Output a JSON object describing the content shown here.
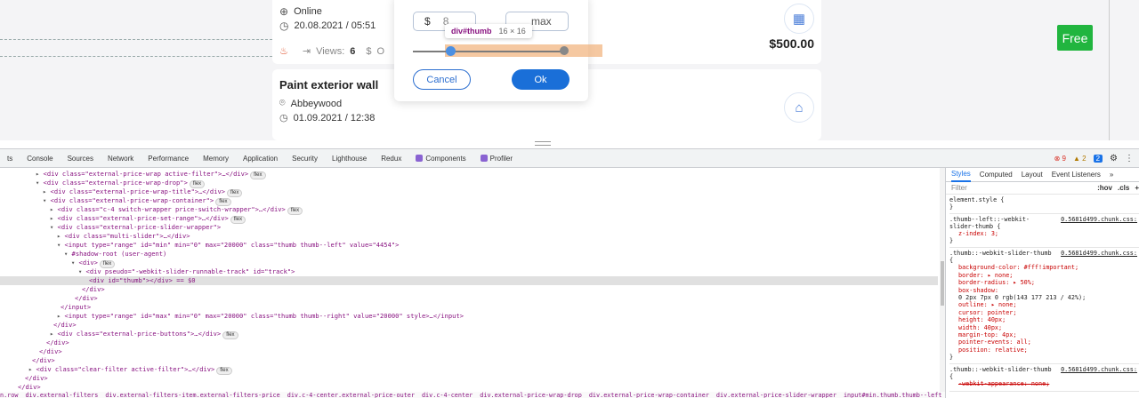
{
  "page": {
    "card1": {
      "location_label": "Online",
      "datetime": "20.08.2021 / 05:51",
      "views_label": "Views:",
      "views_count": "6",
      "offers_fragment": "O",
      "price": "$500.00"
    },
    "card2": {
      "title": "Paint exterior wall",
      "location_label": "Abbeywood",
      "datetime": "01.09.2021 / 12:38"
    },
    "free_button": "Free",
    "filter": {
      "min_prefix": "$",
      "min_value": "8",
      "max_placeholder": "max",
      "cancel_label": "Cancel",
      "ok_label": "Ok",
      "slider": {
        "min": 0,
        "max": 20000,
        "left_value": 4454,
        "right_value": 20000
      }
    },
    "inspect_tooltip": {
      "tag": "div#thumb",
      "size": "16 × 16"
    }
  },
  "devtools": {
    "tabs": [
      "ts",
      "Console",
      "Sources",
      "Network",
      "Performance",
      "Memory",
      "Application",
      "Security",
      "Lighthouse",
      "Redux",
      "Components",
      "Profiler"
    ],
    "errors": "9",
    "warnings": "2",
    "info": "2",
    "styles_tabs": [
      "Styles",
      "Computed",
      "Layout",
      "Event Listeners",
      "»"
    ],
    "filter_placeholder": "Filter",
    "filter_hov": ":hov",
    "filter_cls": ".cls",
    "filter_plus": "+",
    "styles_rules": [
      {
        "selector": "element.style {",
        "source": "",
        "decls": [],
        "close": "}"
      },
      {
        "selector": ".thumb--left::-webkit-slider-thumb {",
        "source": "0.5681d499.chunk.css:",
        "decls": [
          "z-index: 3;"
        ],
        "close": "}"
      },
      {
        "selector": ".thumb::-webkit-slider-thumb {",
        "source": "0.5681d499.chunk.css:",
        "decls": [
          "background-color: #fff!important;",
          "border: ▸ none;",
          "border-radius: ▸ 50%;",
          "box-shadow:",
          "0 2px 7px 0 rgb(143 177 213 / 42%);",
          "outline: ▸ none;",
          "cursor: pointer;",
          "height: 40px;",
          "width: 40px;",
          "margin-top: 4px;",
          "pointer-events: all;",
          "position: relative;"
        ],
        "close": "}"
      },
      {
        "selector": ".thumb::-webkit-slider-thumb {",
        "source": "0.5681d499.chunk.css:",
        "decls": [
          "-webkit-appearance: none;"
        ],
        "close": ""
      }
    ],
    "dom_lines": [
      {
        "indent": 40,
        "text": "<div class=\"external-price-wrap active-filter\">…</div>",
        "pill": "flex",
        "arrow": "▸"
      },
      {
        "indent": 40,
        "text": "<div class=\"external-price-wrap-drop\">",
        "pill": "flex",
        "arrow": "▾"
      },
      {
        "indent": 48,
        "text": "<div class=\"external-price-wrap-title\">…</div>",
        "pill": "flex",
        "arrow": "▸"
      },
      {
        "indent": 48,
        "text": "<div class=\"external-price-wrap-container\">",
        "pill": "flex",
        "arrow": "▾"
      },
      {
        "indent": 56,
        "text": "<div class=\"c-4 switch-wrapper price-switch-wrapper\">…</div>",
        "pill": "flex",
        "arrow": "▸"
      },
      {
        "indent": 56,
        "text": "<div class=\"external-price-set-range\">…</div>",
        "pill": "flex",
        "arrow": "▸"
      },
      {
        "indent": 56,
        "text": "<div class=\"external-price-slider-wrapper\">",
        "pill": "",
        "arrow": "▾"
      },
      {
        "indent": 64,
        "text": "<div class=\"multi-slider\">…</div>",
        "pill": "",
        "arrow": "▸"
      },
      {
        "indent": 64,
        "text": "<input type=\"range\" id=\"min\" min=\"0\" max=\"20000\" class=\"thumb thumb--left\" value=\"4454\">",
        "pill": "",
        "arrow": "▾"
      },
      {
        "indent": 72,
        "text": "#shadow-root (user-agent)",
        "pill": "",
        "arrow": "▾"
      },
      {
        "indent": 80,
        "text": "<div>",
        "pill": "flex",
        "arrow": "▾"
      },
      {
        "indent": 88,
        "text": "<div pseudo=\"-webkit-slider-runnable-track\" id=\"track\">",
        "pill": "",
        "arrow": "▾"
      },
      {
        "indent": 100,
        "text": "<div id=\"thumb\"></div> == $0",
        "pill": "",
        "arrow": "",
        "selected": true
      },
      {
        "indent": 92,
        "text": "</div>",
        "pill": "",
        "arrow": ""
      },
      {
        "indent": 84,
        "text": "</div>",
        "pill": "",
        "arrow": ""
      },
      {
        "indent": 68,
        "text": "</input>",
        "pill": "",
        "arrow": ""
      },
      {
        "indent": 64,
        "text": "<input type=\"range\" id=\"max\" min=\"0\" max=\"20000\" class=\"thumb thumb--right\" value=\"20000\" style>…</input>",
        "pill": "",
        "arrow": "▸"
      },
      {
        "indent": 60,
        "text": "</div>",
        "pill": "",
        "arrow": ""
      },
      {
        "indent": 56,
        "text": "<div class=\"external-price-buttons\">…</div>",
        "pill": "flex",
        "arrow": "▸"
      },
      {
        "indent": 52,
        "text": "</div>",
        "pill": "",
        "arrow": ""
      },
      {
        "indent": 44,
        "text": "</div>",
        "pill": "",
        "arrow": ""
      },
      {
        "indent": 36,
        "text": "</div>",
        "pill": "",
        "arrow": ""
      },
      {
        "indent": 32,
        "text": "<div class=\"clear-filter active-filter\">…</div>",
        "pill": "flex",
        "arrow": "▸"
      },
      {
        "indent": 28,
        "text": "</div>",
        "pill": "",
        "arrow": ""
      },
      {
        "indent": 20,
        "text": "</div>",
        "pill": "",
        "arrow": ""
      }
    ],
    "breadcrumbs": [
      "n.row",
      "div.external-filters",
      "div.external-filters-item.external-filters-price",
      "div.c-4-center.external-price-outer",
      "div.c-4-center",
      "div.external-price-wrap-drop",
      "div.external-price-wrap-container",
      "div.external-price-slider-wrapper",
      "input#min.thumb.thumb--left",
      "#shadow-root",
      "div",
      "div#track",
      "div#thumb"
    ]
  }
}
